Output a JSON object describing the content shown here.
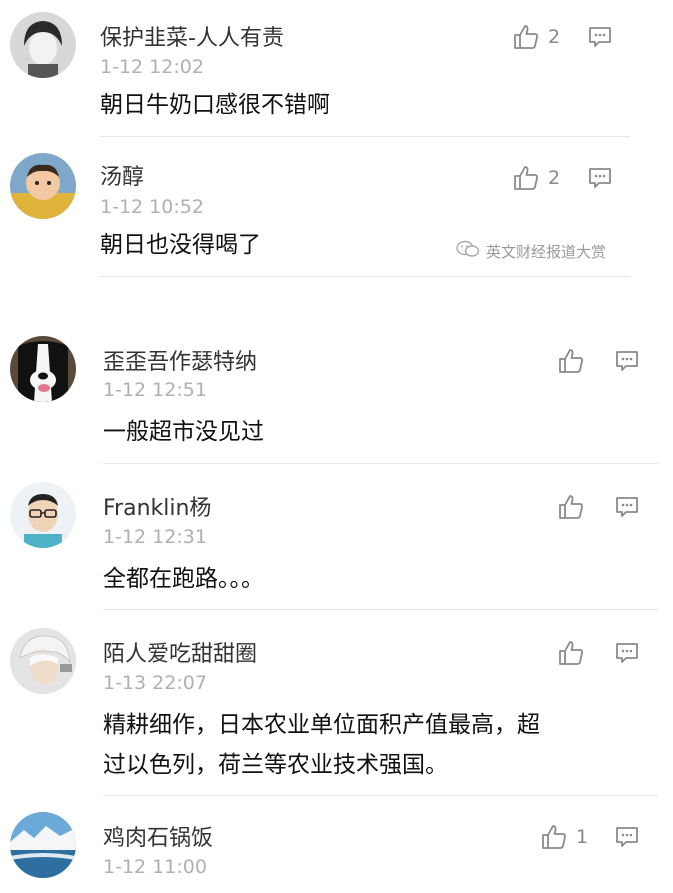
{
  "comments": [
    {
      "user": "保护韭菜-人人有责",
      "time": "1-12 12:02",
      "text": [
        "朝日牛奶口感很不错啊"
      ],
      "likes": "2",
      "avatar": "avatar-short-hair-woman"
    },
    {
      "user": "汤醇",
      "time": "1-12 10:52",
      "text": [
        "朝日也没得喝了"
      ],
      "likes": "2",
      "avatar": "avatar-baby"
    },
    {
      "user": "歪歪吾作瑟特纳",
      "time": "1-12 12:51",
      "text": [
        "一般超市没见过"
      ],
      "likes": "",
      "avatar": "avatar-dog"
    },
    {
      "user": "Franklin杨",
      "time": "1-12 12:31",
      "text": [
        "全都在跑路。。。"
      ],
      "likes": "",
      "avatar": "avatar-glasses-man"
    },
    {
      "user": "陌人爱吃甜甜圈",
      "time": "1-13 22:07",
      "text": [
        "精耕细作，日本农业单位面积产值最高，超",
        "过以色列，荷兰等农业技术强国。"
      ],
      "likes": "",
      "avatar": "avatar-white-hair"
    },
    {
      "user": "鸡肉石锅饭",
      "time": "1-12 11:00",
      "text": [],
      "likes": "1",
      "avatar": "avatar-snow-landscape"
    }
  ],
  "watermark": {
    "text": "英文财经报道大赏",
    "icon": "wechat-icon"
  },
  "icons": {
    "like": "thumbs-up-icon",
    "reply": "comment-bubble-icon"
  },
  "colors": {
    "name": "#333333",
    "time": "#b0b0b0",
    "text": "#111111",
    "divider": "#e6e6e6"
  }
}
